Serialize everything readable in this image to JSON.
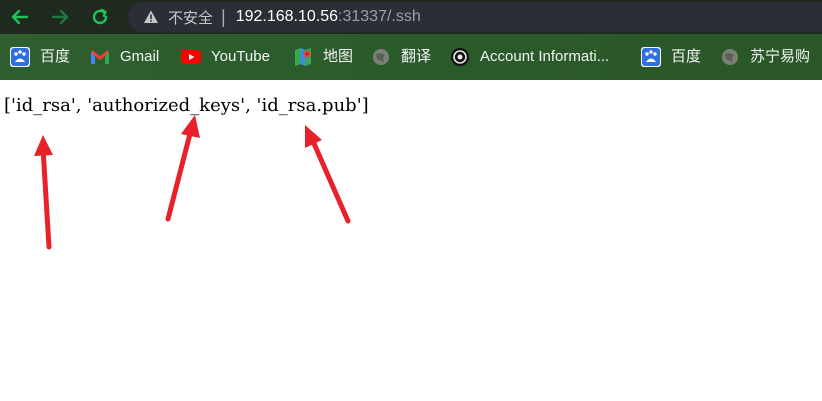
{
  "toolbar": {
    "back_icon": "arrow-left-icon",
    "forward_icon": "arrow-right-icon",
    "reload_icon": "reload-icon",
    "insecure_label": "不安全",
    "separator": "|",
    "url_host": "192.168.10.56",
    "url_path": ":31337/.ssh"
  },
  "bookmarks": [
    {
      "label": "百度",
      "icon": "baidu-icon"
    },
    {
      "label": "Gmail",
      "icon": "gmail-icon"
    },
    {
      "label": "YouTube",
      "icon": "youtube-icon"
    },
    {
      "label": "地图",
      "icon": "maps-icon"
    },
    {
      "label": "翻译",
      "icon": "globe-icon"
    },
    {
      "label": "Account Informati...",
      "icon": "account-icon"
    },
    {
      "label": "百度",
      "icon": "baidu-icon"
    },
    {
      "label": "苏宁易购",
      "icon": "globe-icon"
    }
  ],
  "page": {
    "listing": "['id_rsa', 'authorized_keys', 'id_rsa.pub']"
  },
  "colors": {
    "arrow": "#e8212b",
    "bookmarks_bar": "#2f5f2e",
    "toolbar": "#1f2a1e",
    "omnibox": "#2b2f35",
    "nav_green": "#21c15a"
  }
}
